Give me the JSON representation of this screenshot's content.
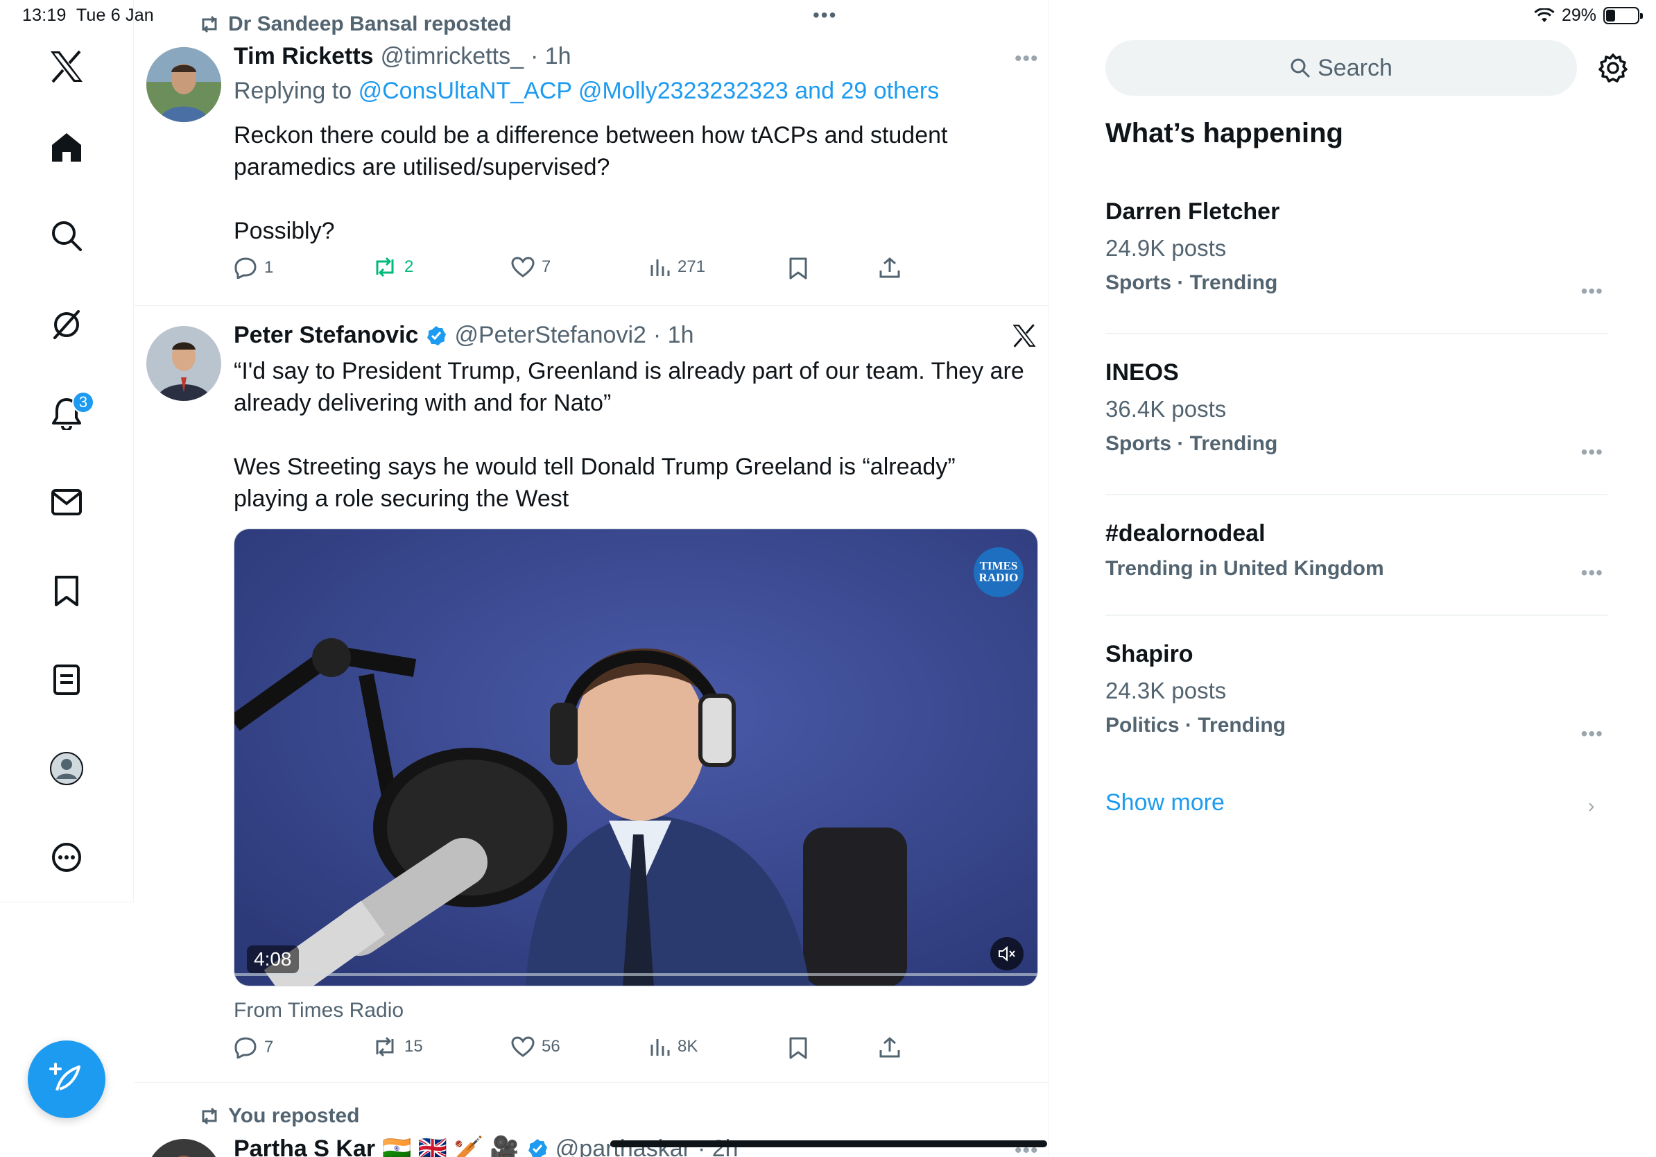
{
  "status_bar": {
    "time": "13:19",
    "date": "Tue 6 Jan",
    "battery": "29%",
    "battery_level": 0.29
  },
  "nav": {
    "items": [
      {
        "name": "x-logo-icon"
      },
      {
        "name": "home-icon"
      },
      {
        "name": "search-icon"
      },
      {
        "name": "grok-icon"
      },
      {
        "name": "notifications-icon"
      },
      {
        "name": "messages-icon"
      },
      {
        "name": "bookmarks-icon"
      },
      {
        "name": "lists-icon"
      },
      {
        "name": "profile-icon"
      },
      {
        "name": "more-icon"
      }
    ],
    "notification_count": "3"
  },
  "timeline": {
    "tweet1": {
      "repost_label": "Dr Sandeep Bansal reposted",
      "name": "Tim Ricketts",
      "handle": "@timricketts_",
      "time": "· 1h",
      "replying_prefix": "Replying to",
      "replying_users": "@ConsUltaNT_ACP @Molly2323232323 and 29 others",
      "text_line1": "Reckon there could be a difference between how tACPs and student",
      "text_line2": "paramedics are utilised/supervised?",
      "text_line3": "Possibly?",
      "replies": "1",
      "reposts": "2",
      "likes": "7",
      "views": "271"
    },
    "tweet2": {
      "name": "Peter Stefanovic",
      "handle": "@PeterStefanovi2",
      "time": "· 1h",
      "text_line1": "“I'd say to President Trump, Greenland is already part of our team. They are",
      "text_line2": "already delivering with and for Nato”",
      "text_line3": "Wes Streeting says he would tell Donald Trump Greeland is “already”",
      "text_line4": "playing a role securing the West",
      "video_duration": "4:08",
      "media_logo_text_1": "TIMES",
      "media_logo_text_2": "RADIO",
      "source": "From Times Radio",
      "replies": "7",
      "reposts": "15",
      "likes": "56",
      "views": "8K"
    },
    "tweet3": {
      "repost_label": "You reposted",
      "name": "Partha S Kar",
      "flags": "🇮🇳 🇬🇧 🏏 🎥",
      "handle": "@parthaskar",
      "time": "· 2h"
    }
  },
  "sidebar": {
    "search_placeholder": "Search",
    "trends_title": "What’s happening",
    "trends": [
      {
        "name": "Darren Fletcher",
        "count": "24.9K posts",
        "category": "Sports · Trending"
      },
      {
        "name": "INEOS",
        "count": "36.4K posts",
        "category": "Sports · Trending"
      },
      {
        "name": "#dealornodeal",
        "count": "",
        "category": "Trending in United Kingdom"
      },
      {
        "name": "Shapiro",
        "count": "24.3K posts",
        "category": "Politics · Trending"
      }
    ],
    "show_more": "Show more"
  },
  "colors": {
    "accent": "#1d9bf0",
    "text": "#0f1419",
    "muted": "#536471",
    "repost_green": "#00ba7c"
  }
}
